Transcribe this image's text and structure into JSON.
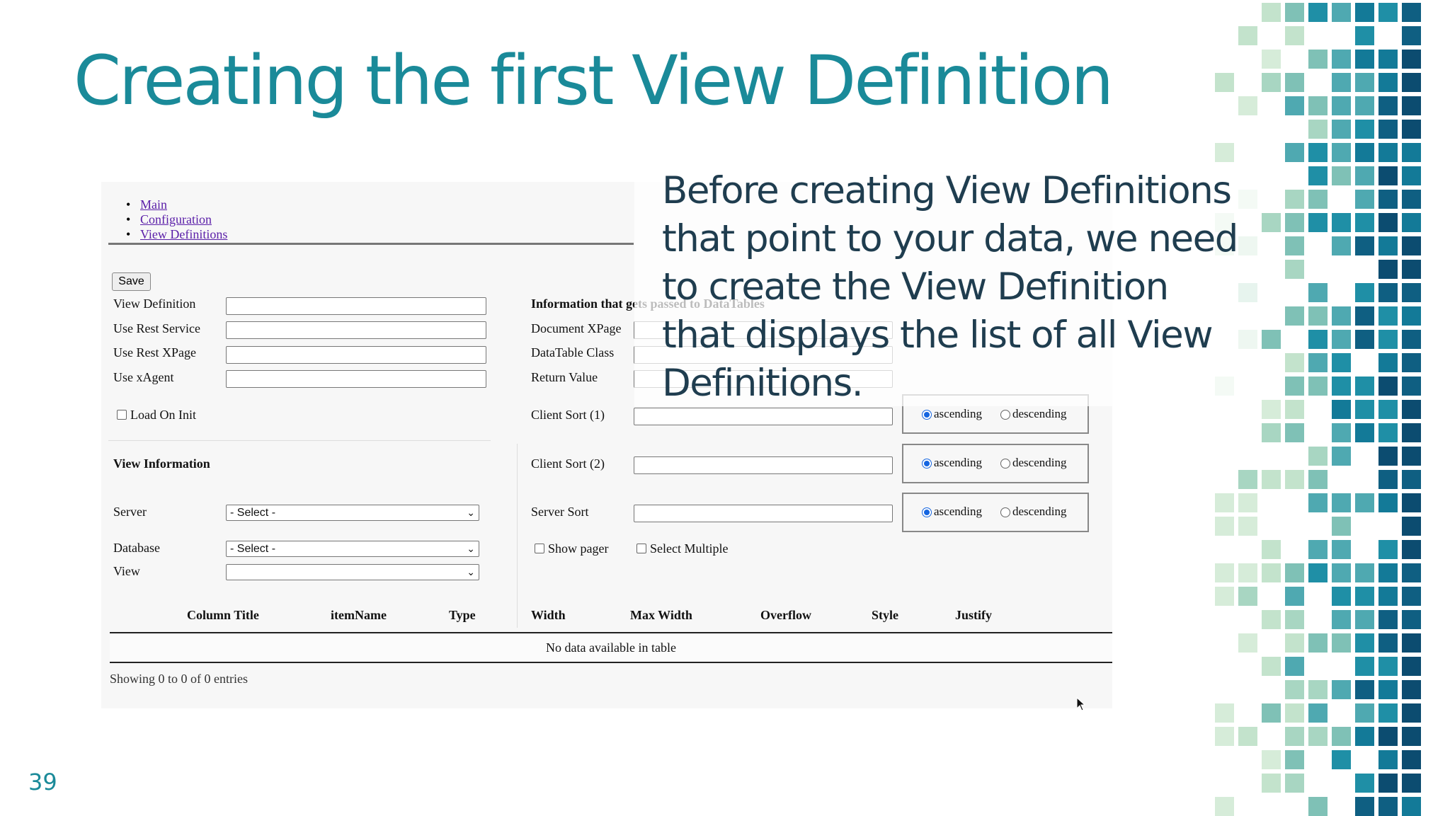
{
  "slide": {
    "title": "Creating the first View Definition",
    "page_number": "39",
    "callout": "Before creating View Definitions that point to your data, we need to create the View Definition that displays the list of all View Definitions."
  },
  "colors": {
    "title": "#1a8a99",
    "callout_text": "#1f3d4f",
    "link": "#5a1ea8",
    "radio_on": "#1565e0"
  },
  "screenshot": {
    "nav": [
      "Main",
      "Configuration",
      "View Definitions"
    ],
    "save_button": "Save",
    "left_fields": [
      "View Definition",
      "Use Rest Service",
      "Use Rest XPage",
      "Use xAgent"
    ],
    "load_on_init": "Load On Init",
    "view_info_heading": "View Information",
    "server_label": "Server",
    "server_value": "- Select -",
    "database_label": "Database",
    "database_value": "- Select -",
    "view_label": "View",
    "view_value": "",
    "info_heading": "Information that gets passed to DataTables",
    "right_fields": [
      "Document XPage",
      "DataTable Class",
      "Return Value"
    ],
    "sorts": [
      {
        "label": "Client Sort (1)",
        "selected": "ascending"
      },
      {
        "label": "Client Sort (2)",
        "selected": "ascending"
      },
      {
        "label": "Server Sort",
        "selected": "ascending"
      }
    ],
    "sort_options": [
      "ascending",
      "descending"
    ],
    "show_pager": "Show pager",
    "select_multiple": "Select Multiple",
    "table_columns": [
      "Column Title",
      "itemName",
      "Type",
      "Width",
      "Max Width",
      "Overflow",
      "Style",
      "Justify"
    ],
    "empty_message": "No data available in table",
    "info_text": "Showing 0 to 0 of 0 entries"
  }
}
